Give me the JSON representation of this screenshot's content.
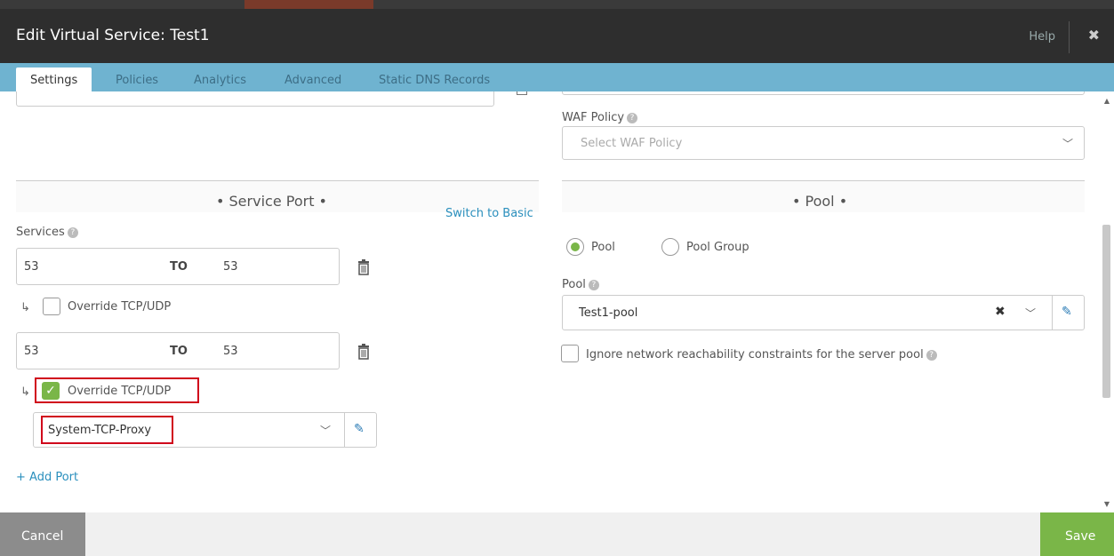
{
  "header": {
    "title": "Edit Virtual Service: Test1",
    "help_label": "Help",
    "close_glyph": "✖"
  },
  "tabs": [
    {
      "label": "Settings",
      "active": true
    },
    {
      "label": "Policies",
      "active": false
    },
    {
      "label": "Analytics",
      "active": false
    },
    {
      "label": "Advanced",
      "active": false
    },
    {
      "label": "Static DNS Records",
      "active": false
    }
  ],
  "waf": {
    "label": "WAF Policy",
    "placeholder": "Select WAF Policy"
  },
  "service_port": {
    "title": "• Service Port •",
    "switch_link": "Switch to Basic",
    "services_label": "Services",
    "rows": [
      {
        "from": "53",
        "to_label": "TO",
        "to": "53",
        "override_label": "Override TCP/UDP",
        "override_checked": false
      },
      {
        "from": "53",
        "to_label": "TO",
        "to": "53",
        "override_label": "Override TCP/UDP",
        "override_checked": true
      }
    ],
    "profile_value": "System-TCP-Proxy",
    "add_port": "+ Add Port"
  },
  "pool": {
    "title": "• Pool •",
    "radio_pool": "Pool",
    "radio_pool_group": "Pool Group",
    "pool_label": "Pool",
    "pool_value": "Test1-pool",
    "ignore_label": "Ignore network reachability constraints for the server pool"
  },
  "footer": {
    "cancel": "Cancel",
    "save": "Save"
  },
  "colors": {
    "accent_green": "#7ab648",
    "tab_bar": "#6fb3d0",
    "highlight_red": "#d0021b",
    "link_blue": "#2a8fbd"
  }
}
